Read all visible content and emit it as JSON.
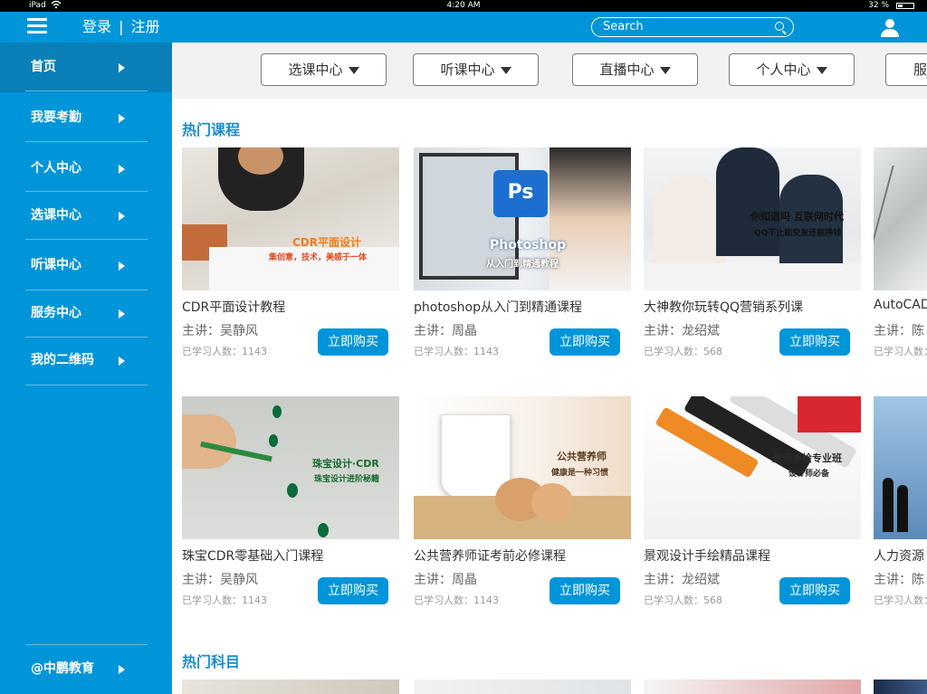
{
  "status": {
    "device": "iPad",
    "time": "4:20 AM",
    "battery": "32 %",
    "battery_level": 0.32
  },
  "header": {
    "login_label": "登录",
    "divider": "|",
    "register_label": "注册",
    "search_placeholder": "Search"
  },
  "sidebar": {
    "items": [
      {
        "label": "首页"
      },
      {
        "label": "我要考勤"
      },
      {
        "label": "个人中心"
      },
      {
        "label": "选课中心"
      },
      {
        "label": "听课中心"
      },
      {
        "label": "服务中心"
      },
      {
        "label": "我的二维码"
      }
    ],
    "footer_label": "@中鹏教育"
  },
  "tabs": [
    {
      "label": "选课中心"
    },
    {
      "label": "听课中心"
    },
    {
      "label": "直播中心"
    },
    {
      "label": "个人中心"
    },
    {
      "label": "服"
    }
  ],
  "sections": {
    "hot_courses": "热门课程",
    "hot_subjects": "热门科目"
  },
  "teacher_prefix": "主讲：",
  "count_prefix": "已学习人数：",
  "buy_label": "立即购买",
  "courses": [
    {
      "title": "CDR平面设计教程",
      "teacher": "吴静风",
      "count": "1143",
      "overlay_title": "CDR平面设计",
      "overlay_sub": "集创意，技术，美感于一体"
    },
    {
      "title": "photoshop从入门到精通课程",
      "teacher": "周晶",
      "count": "1143",
      "overlay_title": "Photoshop",
      "overlay_sub": "从入门到精通教程",
      "logo": "Ps"
    },
    {
      "title": "大神教你玩转QQ营销系列课",
      "teacher": "龙绍斌",
      "count": "568",
      "overlay_title": "你知道吗 互联网时代",
      "overlay_sub": "QQ不止能交友还能挣钱"
    },
    {
      "title": "AutoCAD",
      "teacher": "陈",
      "count": ""
    },
    {
      "title": "珠宝CDR零基础入门课程",
      "teacher": "吴静风",
      "count": "1143",
      "overlay_title": "珠宝设计·CDR",
      "overlay_sub": "珠宝设计进阶秘籍"
    },
    {
      "title": "公共营养师证考前必修课程",
      "teacher": "周晶",
      "count": "1143",
      "overlay_title": "公共营养师",
      "overlay_sub": "健康是一种习惯"
    },
    {
      "title": "景观设计手绘精品课程",
      "teacher": "龙绍斌",
      "count": "568",
      "overlay_title": "景观手绘专业班",
      "overlay_sub": "设计师必备"
    },
    {
      "title": "人力资源",
      "teacher": "陈",
      "count": ""
    }
  ]
}
